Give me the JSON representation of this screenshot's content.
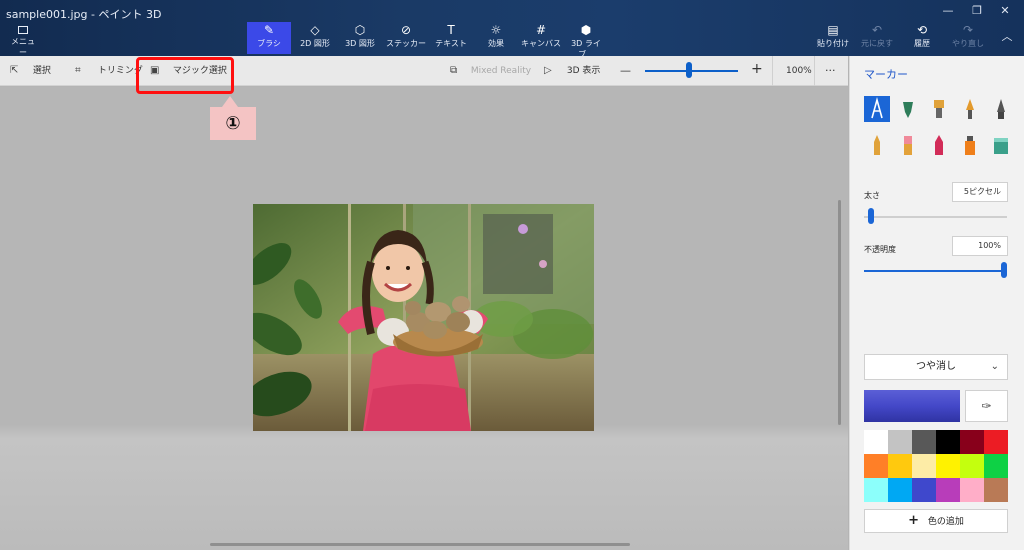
{
  "window": {
    "title": "sample001.jpg - ペイント 3D"
  },
  "menu": {
    "label": "メニュー"
  },
  "ribbon": {
    "tools": [
      {
        "label": "ブラシ",
        "icon": "brush-icon"
      },
      {
        "label": "2D 図形",
        "icon": "2d-shapes-icon"
      },
      {
        "label": "3D 図形",
        "icon": "3d-shapes-icon"
      },
      {
        "label": "ステッカー",
        "icon": "sticker-icon"
      },
      {
        "label": "テキスト",
        "icon": "text-icon"
      },
      {
        "label": "効果",
        "icon": "effects-icon"
      },
      {
        "label": "キャンバス",
        "icon": "canvas-icon"
      },
      {
        "label": "3D ライブ...",
        "icon": "3d-library-icon"
      }
    ],
    "right": [
      {
        "label": "貼り付け",
        "icon": "paste-icon"
      },
      {
        "label": "元に戻す",
        "icon": "undo-icon"
      },
      {
        "label": "履歴",
        "icon": "history-icon"
      },
      {
        "label": "やり直し",
        "icon": "redo-icon"
      }
    ]
  },
  "toolbar": {
    "select": "選択",
    "crop": "トリミング",
    "magic_select": "マジック選択",
    "mixed_reality": "Mixed Reality",
    "view_3d": "3D 表示",
    "zoom_minus": "—",
    "zoom_plus": "+",
    "zoom_level": "100%",
    "zoom_fraction": 0.47,
    "more": "···"
  },
  "callout": {
    "text": "①"
  },
  "panel": {
    "title": "マーカー",
    "thickness_label": "太さ",
    "thickness_value": "5ピクセル",
    "thickness_fraction": 0.05,
    "opacity_label": "不透明度",
    "opacity_value": "100%",
    "opacity_fraction": 1.0,
    "finish": "つや消し",
    "current_color": "#4448c8",
    "add_color": "色の追加",
    "swatches": [
      "#ffffff",
      "#c3c3c3",
      "#585858",
      "#000000",
      "#88001b",
      "#ec1c24",
      "#ff7f27",
      "#ffc90e",
      "#fdeca6",
      "#fff200",
      "#c4ff0e",
      "#0ed145",
      "#8cfffb",
      "#00a8f3",
      "#3f48cc",
      "#b83dba",
      "#ffaec8",
      "#b97a56"
    ]
  },
  "colors": {
    "accent": "#1b66d6",
    "highlight": "#ff1010"
  }
}
